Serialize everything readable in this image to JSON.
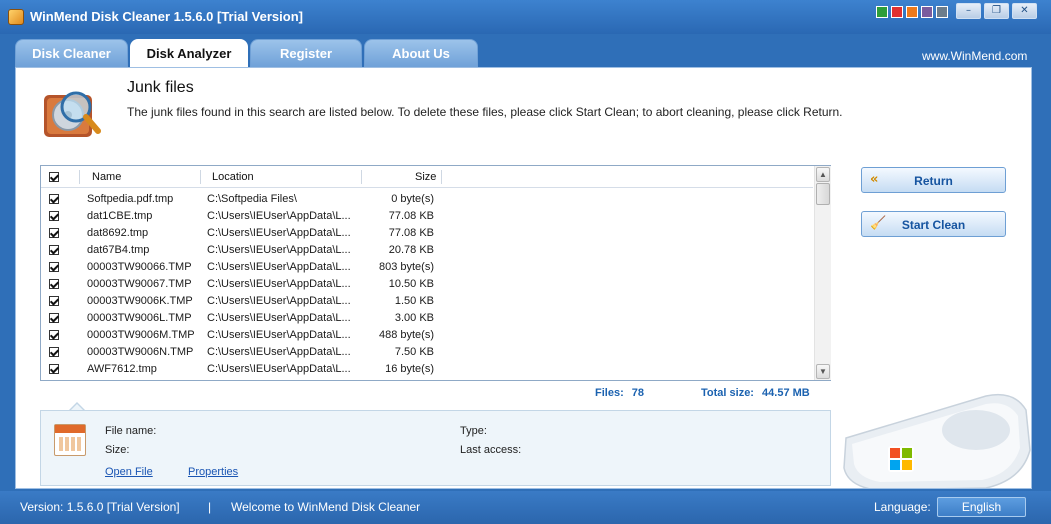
{
  "window": {
    "title": "WinMend Disk Cleaner 1.5.6.0 [Trial Version]",
    "skin_colors": [
      "#2e9e3a",
      "#e03030",
      "#ee7a1c",
      "#7a5c9e",
      "#6c7d8c"
    ],
    "controls": {
      "minimize": "–",
      "restore": "❐",
      "close": "✕"
    }
  },
  "tabs": [
    {
      "label": "Disk Cleaner",
      "active": false
    },
    {
      "label": "Disk Analyzer",
      "active": true
    },
    {
      "label": "Register",
      "active": false
    },
    {
      "label": "About Us",
      "active": false
    }
  ],
  "site_link": "www.WinMend.com",
  "header": {
    "title": "Junk files",
    "description": "The junk files found in this search are listed below. To delete these files, please click Start Clean; to abort cleaning, please click Return."
  },
  "file_list": {
    "columns": {
      "name": "Name",
      "location": "Location",
      "size": "Size"
    },
    "rows": [
      {
        "name": "Softpedia.pdf.tmp",
        "location": "C:\\Softpedia Files\\",
        "size": "0 byte(s)"
      },
      {
        "name": "dat1CBE.tmp",
        "location": "C:\\Users\\IEUser\\AppData\\L...",
        "size": "77.08 KB"
      },
      {
        "name": "dat8692.tmp",
        "location": "C:\\Users\\IEUser\\AppData\\L...",
        "size": "77.08 KB"
      },
      {
        "name": "dat67B4.tmp",
        "location": "C:\\Users\\IEUser\\AppData\\L...",
        "size": "20.78 KB"
      },
      {
        "name": "00003TW90066.TMP",
        "location": "C:\\Users\\IEUser\\AppData\\L...",
        "size": "803 byte(s)"
      },
      {
        "name": "00003TW90067.TMP",
        "location": "C:\\Users\\IEUser\\AppData\\L...",
        "size": "10.50 KB"
      },
      {
        "name": "00003TW9006K.TMP",
        "location": "C:\\Users\\IEUser\\AppData\\L...",
        "size": "1.50 KB"
      },
      {
        "name": "00003TW9006L.TMP",
        "location": "C:\\Users\\IEUser\\AppData\\L...",
        "size": "3.00 KB"
      },
      {
        "name": "00003TW9006M.TMP",
        "location": "C:\\Users\\IEUser\\AppData\\L...",
        "size": "488 byte(s)"
      },
      {
        "name": "00003TW9006N.TMP",
        "location": "C:\\Users\\IEUser\\AppData\\L...",
        "size": "7.50 KB"
      },
      {
        "name": "AWF7612.tmp",
        "location": "C:\\Users\\IEUser\\AppData\\L...",
        "size": "16 byte(s)"
      }
    ]
  },
  "summary": {
    "files_label": "Files:",
    "files_value": "78",
    "total_label": "Total size:",
    "total_value": "44.57 MB"
  },
  "actions": {
    "return_label": "Return",
    "return_icon": "double-chevron-left",
    "clean_label": "Start Clean",
    "clean_icon": "broom"
  },
  "details": {
    "file_name_label": "File name:",
    "size_label": "Size:",
    "type_label": "Type:",
    "last_access_label": "Last access:",
    "open_file_link": "Open File",
    "properties_link": "Properties"
  },
  "status_bar": {
    "version": "Version:  1.5.6.0 [Trial Version]",
    "separator": "|",
    "welcome": "Welcome to WinMend Disk Cleaner",
    "language_label": "Language:",
    "language_value": "English"
  }
}
